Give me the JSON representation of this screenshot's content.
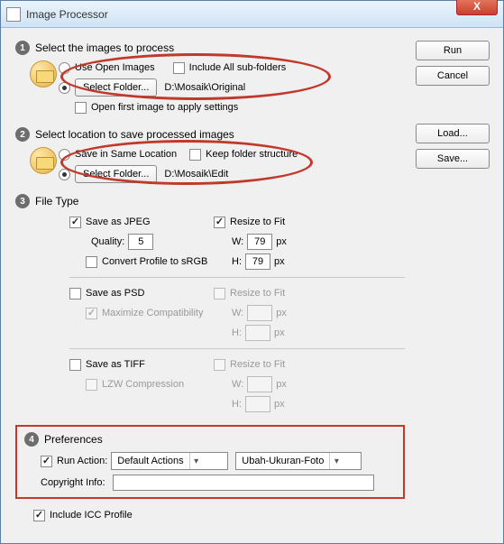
{
  "window": {
    "title": "Image Processor",
    "close": "X"
  },
  "buttons": {
    "run": "Run",
    "cancel": "Cancel",
    "load": "Load...",
    "save": "Save..."
  },
  "sec1": {
    "num": "1",
    "title": "Select the images to process",
    "useOpen": "Use Open Images",
    "includeSub": "Include All sub-folders",
    "selectFolder": "Select Folder...",
    "path": "D:\\Mosaik\\Original",
    "openFirst": "Open first image to apply settings"
  },
  "sec2": {
    "num": "2",
    "title": "Select location to save processed images",
    "saveSame": "Save in Same Location",
    "keepFolder": "Keep folder structure",
    "selectFolder": "Select Folder...",
    "path": "D:\\Mosaik\\Edit"
  },
  "sec3": {
    "num": "3",
    "title": "File Type",
    "jpeg": {
      "save": "Save as JPEG",
      "resize": "Resize to Fit",
      "qualityLabel": "Quality:",
      "quality": "5",
      "wLabel": "W:",
      "w": "79",
      "hLabel": "H:",
      "h": "79",
      "px": "px",
      "convert": "Convert Profile to sRGB"
    },
    "psd": {
      "save": "Save as PSD",
      "resize": "Resize to Fit",
      "maximize": "Maximize Compatibility",
      "wLabel": "W:",
      "hLabel": "H:",
      "px": "px"
    },
    "tiff": {
      "save": "Save as TIFF",
      "resize": "Resize to Fit",
      "lzw": "LZW Compression",
      "wLabel": "W:",
      "hLabel": "H:",
      "px": "px"
    }
  },
  "pref": {
    "num": "4",
    "title": "Preferences",
    "runAction": "Run Action:",
    "dd1": "Default Actions",
    "dd2": "Ubah-Ukuran-Foto",
    "copyright": "Copyright Info:"
  },
  "includeICC": "Include ICC Profile"
}
